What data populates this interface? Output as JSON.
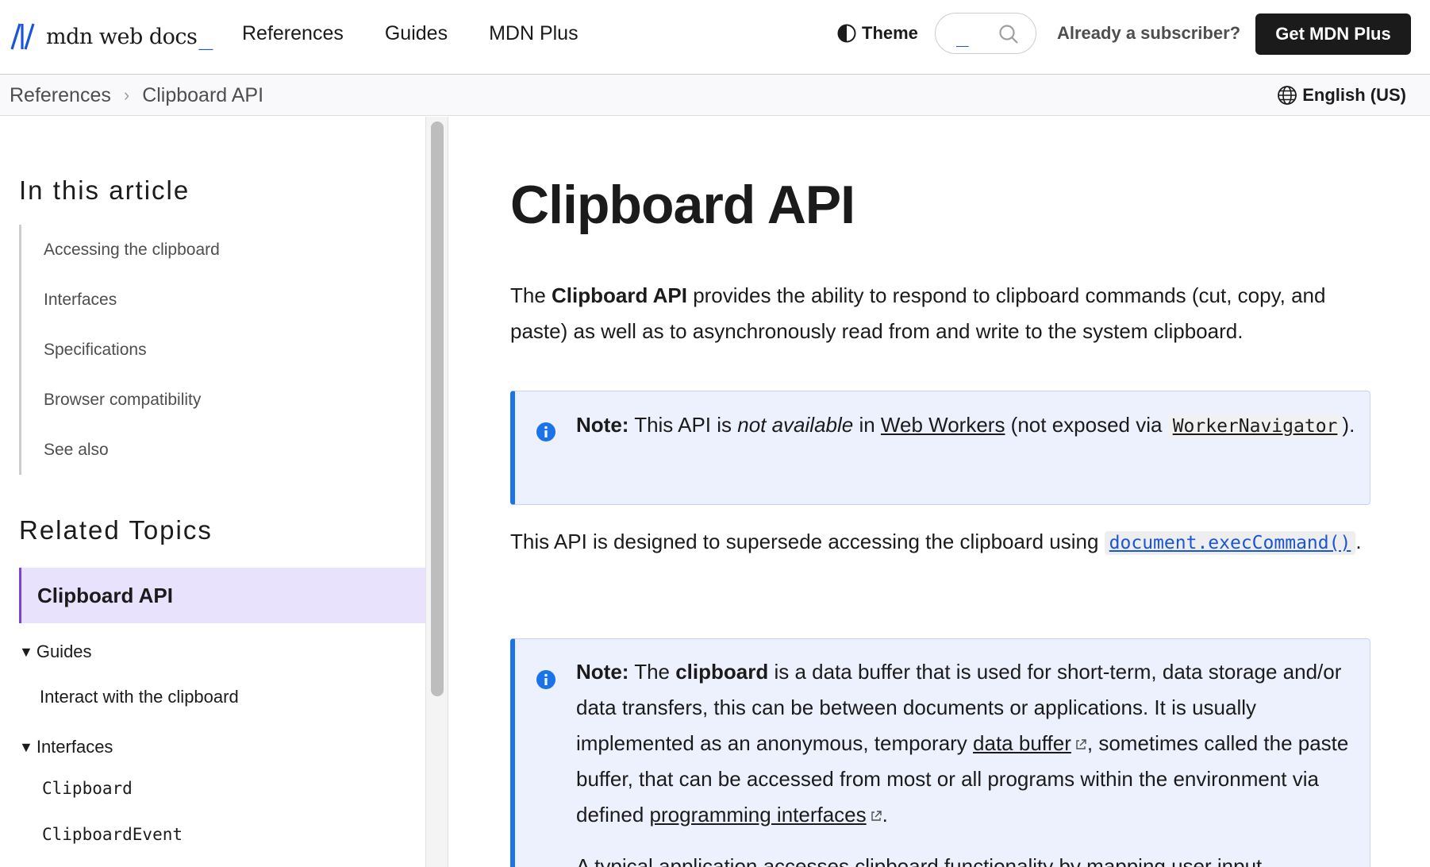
{
  "header": {
    "logo_text": "mdn web docs",
    "logo_underscore": "_",
    "nav": [
      "References",
      "Guides",
      "MDN Plus"
    ],
    "theme_label": "Theme",
    "search_caret": "_",
    "subscriber_link": "Already a subscriber?",
    "cta_label": "Get MDN Plus"
  },
  "breadcrumb": {
    "items": [
      "References",
      "Clipboard API"
    ],
    "separator": "›",
    "language": "English (US)"
  },
  "sidebar": {
    "toc_title": "In this article",
    "toc_items": [
      "Accessing the clipboard",
      "Interfaces",
      "Specifications",
      "Browser compatibility",
      "See also"
    ],
    "related_title": "Related Topics",
    "related_active": "Clipboard API",
    "groups": [
      {
        "label": "Guides",
        "items": [
          "Interact with the clipboard"
        ]
      },
      {
        "label": "Interfaces",
        "items": [
          "Clipboard",
          "ClipboardEvent"
        ]
      }
    ],
    "triangle": "▼"
  },
  "main": {
    "title": "Clipboard API",
    "intro": {
      "prefix": "The ",
      "bold": "Clipboard API",
      "suffix": " provides the ability to respond to clipboard commands (cut, copy, and paste) as well as to asynchronously read from and write to the system clipboard."
    },
    "note1": {
      "label": "Note:",
      "text1": " This API is ",
      "italic": "not available",
      "text2": " in ",
      "link": "Web Workers",
      "text3": " (not exposed via ",
      "code": "WorkerNavigator",
      "text4": ")."
    },
    "para2": {
      "text": "This API is designed to supersede accessing the clipboard using ",
      "code_link": "document.execCommand()",
      "end": "."
    },
    "note2": {
      "label": "Note:",
      "t1": " The ",
      "bold": "clipboard",
      "t2": " is a data buffer that is used for short-term, data storage and/or data transfers, this can be between documents or applications. It is usually implemented as an anonymous, temporary ",
      "link1": "data buffer",
      "t3": ", sometimes called the paste buffer, that can be accessed from most or all programs within the environment via defined ",
      "link2": "programming interfaces",
      "t4": ".",
      "next_line": "A typical application accesses clipboard functionality by mapping user input"
    }
  },
  "colors": {
    "accent_blue": "#1a55d8",
    "note_border": "#1a73e8",
    "note_bg": "#ecf1fd",
    "active_bg": "#e8e2fc",
    "active_border": "#7b44d6",
    "cta_bg": "#1b1b1b"
  },
  "icons": [
    "mdn-logo-icon",
    "theme-icon",
    "search-icon",
    "chevron-right-icon",
    "globe-icon",
    "info-icon",
    "external-link-icon"
  ]
}
